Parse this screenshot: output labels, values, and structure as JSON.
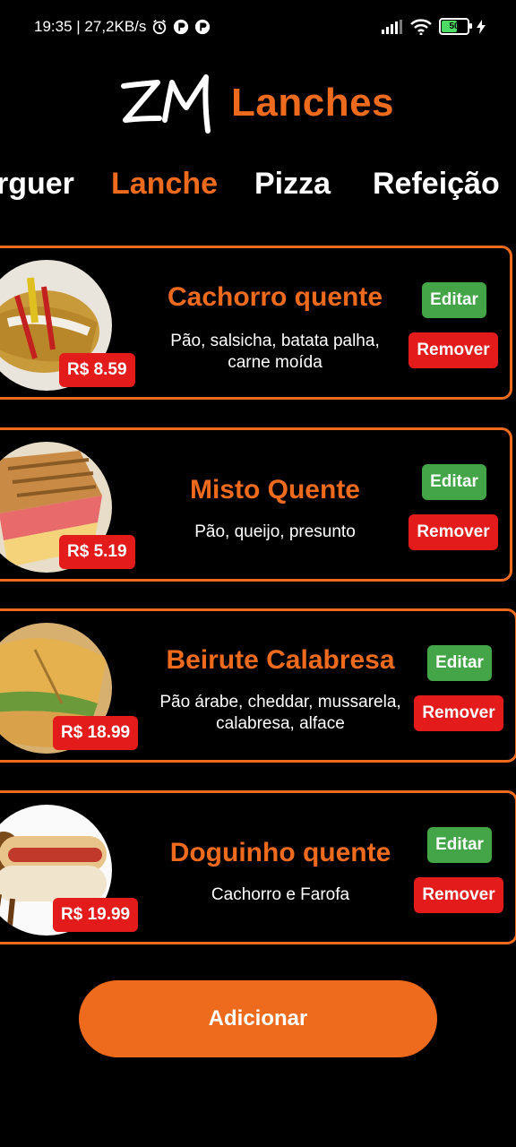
{
  "status_bar": {
    "time_info": "19:35 | 27,2KB/s",
    "battery": "50",
    "icons": [
      "alarm-icon",
      "app-icon",
      "app-icon",
      "signal-icon",
      "wifi-icon",
      "battery-icon",
      "charging-icon"
    ]
  },
  "header": {
    "logo_mark": "ZM",
    "brand": "Lanches"
  },
  "tabs": [
    {
      "label": "rguer"
    },
    {
      "label": "Lanche",
      "active": true
    },
    {
      "label": "Pizza"
    },
    {
      "label": "Refeição"
    }
  ],
  "products": [
    {
      "name": "Cachorro quente",
      "desc_line1": "Pão, salsicha, batata palha,",
      "desc_line2": "carne moída",
      "price": "R$ 8.59",
      "edit_label": "Editar",
      "remove_label": "Remover"
    },
    {
      "name": "Misto Quente",
      "desc_line1": "Pão, queijo, presunto",
      "desc_line2": "",
      "price": "R$ 5.19",
      "edit_label": "Editar",
      "remove_label": "Remover"
    },
    {
      "name": "Beirute Calabresa",
      "desc_line1": "Pão árabe, cheddar, mussarela,",
      "desc_line2": "calabresa, alface",
      "price": "R$ 18.99",
      "edit_label": "Editar",
      "remove_label": "Remover"
    },
    {
      "name": "Doguinho quente",
      "desc_line1": "Cachorro e Farofa",
      "desc_line2": "",
      "price": "R$ 19.99",
      "edit_label": "Editar",
      "remove_label": "Remover"
    }
  ],
  "add_button": "Adicionar",
  "colors": {
    "accent": "#ee6b1e",
    "remove": "#e31b1b",
    "edit": "#43a547",
    "background": "#000000"
  }
}
